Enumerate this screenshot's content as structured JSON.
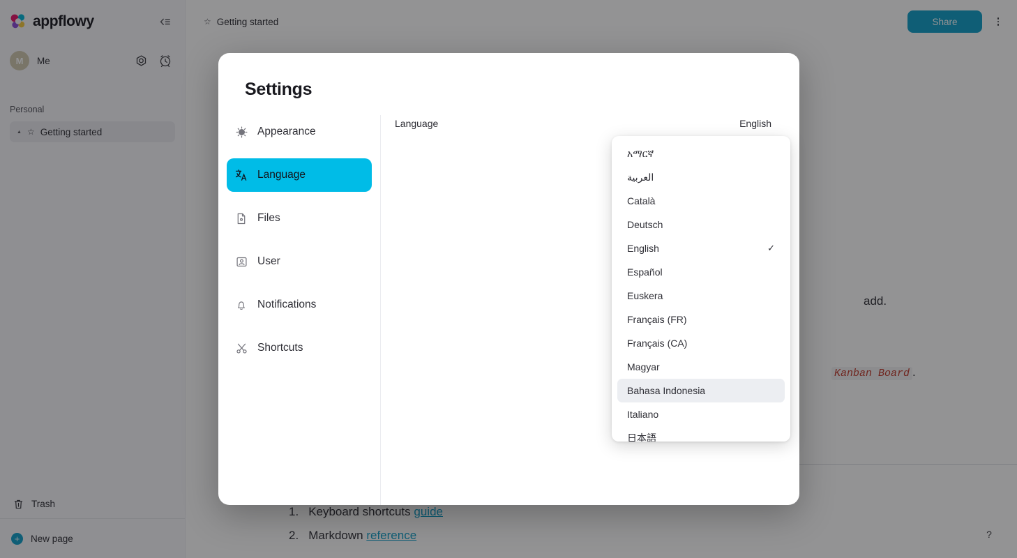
{
  "sidebar": {
    "brand": "appflowy",
    "collapse_icon": "collapse-sidebar-icon",
    "user": {
      "name": "Me",
      "avatar_initial": "M",
      "settings_icon": "gear-icon",
      "clock_icon": "alarm-clock-icon"
    },
    "section_label": "Personal",
    "page": {
      "label": "Getting started",
      "star_icon": "star-icon",
      "expand_icon": "triangle-icon"
    },
    "trash": {
      "label": "Trash",
      "icon": "trash-icon"
    },
    "new_page": {
      "label": "New page",
      "icon": "plus-circle-icon"
    }
  },
  "topbar": {
    "breadcrumb": "Getting started",
    "breadcrumb_icon": "star-icon",
    "share_label": "Share",
    "more_icon": "kebab-menu-icon"
  },
  "document": {
    "line_add": "add.",
    "line_kanban_prefix": "",
    "line_kanban_code": "Kanban Board",
    "line_kanban_suffix": ".",
    "list": [
      {
        "num": "1.",
        "text": "Keyboard shortcuts ",
        "link": "guide"
      },
      {
        "num": "2.",
        "text": "Markdown ",
        "link": "reference"
      }
    ]
  },
  "help": {
    "icon": "question-mark-icon",
    "label": "?"
  },
  "settings": {
    "title": "Settings",
    "nav": [
      {
        "label": "Appearance",
        "icon": "brightness-icon",
        "active": false
      },
      {
        "label": "Language",
        "icon": "translate-icon",
        "active": true
      },
      {
        "label": "Files",
        "icon": "file-icon",
        "active": false
      },
      {
        "label": "User",
        "icon": "user-card-icon",
        "active": false
      },
      {
        "label": "Notifications",
        "icon": "bell-icon",
        "active": false
      },
      {
        "label": "Shortcuts",
        "icon": "scissors-icon",
        "active": false
      }
    ],
    "panel": {
      "language_label": "Language",
      "language_value": "English"
    }
  },
  "language_menu": {
    "selected": "English",
    "hovered": "Bahasa Indonesia",
    "check_icon": "check-icon",
    "items": [
      {
        "label": "አማርኛ",
        "rtl": false,
        "selected": false,
        "hovered": false
      },
      {
        "label": "العربية",
        "rtl": true,
        "selected": false,
        "hovered": false
      },
      {
        "label": "Català",
        "rtl": false,
        "selected": false,
        "hovered": false
      },
      {
        "label": "Deutsch",
        "rtl": false,
        "selected": false,
        "hovered": false
      },
      {
        "label": "English",
        "rtl": false,
        "selected": true,
        "hovered": false
      },
      {
        "label": "Español",
        "rtl": false,
        "selected": false,
        "hovered": false
      },
      {
        "label": "Euskera",
        "rtl": false,
        "selected": false,
        "hovered": false
      },
      {
        "label": "Français (FR)",
        "rtl": false,
        "selected": false,
        "hovered": false
      },
      {
        "label": "Français (CA)",
        "rtl": false,
        "selected": false,
        "hovered": false
      },
      {
        "label": "Magyar",
        "rtl": false,
        "selected": false,
        "hovered": false
      },
      {
        "label": "Bahasa Indonesia",
        "rtl": false,
        "selected": false,
        "hovered": true
      },
      {
        "label": "Italiano",
        "rtl": false,
        "selected": false,
        "hovered": false
      },
      {
        "label": "日本語",
        "rtl": false,
        "selected": false,
        "hovered": false
      }
    ]
  },
  "colors": {
    "accent": "#00bce7",
    "brand_blue": "#0f9ec9",
    "code_red": "#c0392b",
    "sidebar_bg": "#f7f8fc"
  }
}
